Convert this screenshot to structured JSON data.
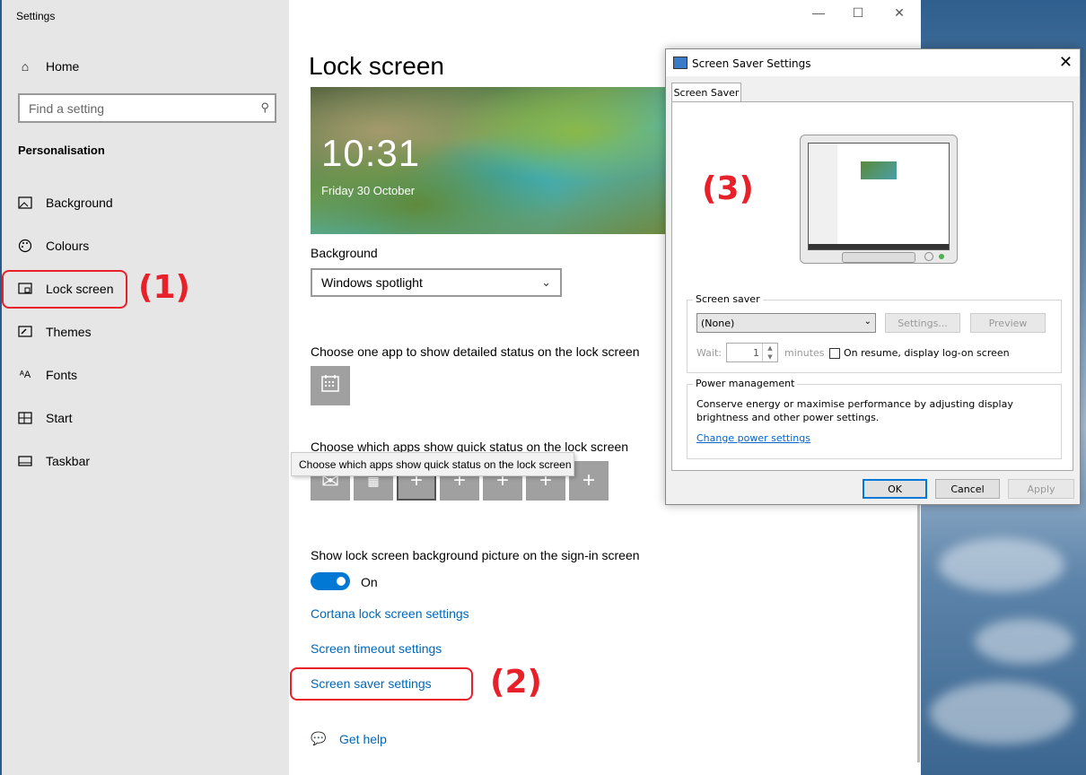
{
  "settings": {
    "window_title": "Settings",
    "home_label": "Home",
    "search_placeholder": "Find a setting",
    "section_title": "Personalisation",
    "nav_items": [
      {
        "label": "Background",
        "icon": "image-icon"
      },
      {
        "label": "Colours",
        "icon": "palette-icon"
      },
      {
        "label": "Lock screen",
        "icon": "lock-screen-icon"
      },
      {
        "label": "Themes",
        "icon": "brush-icon"
      },
      {
        "label": "Fonts",
        "icon": "font-icon"
      },
      {
        "label": "Start",
        "icon": "start-icon"
      },
      {
        "label": "Taskbar",
        "icon": "taskbar-icon"
      }
    ]
  },
  "main": {
    "title": "Lock screen",
    "preview_time": "10:31",
    "preview_date": "Friday 30 October",
    "background_label": "Background",
    "background_value": "Windows spotlight",
    "detailed_status_label": "Choose one app to show detailed status on the lock screen",
    "quick_status_label": "Choose which apps show quick status on the lock screen",
    "tooltip_text": "Choose which apps show quick status on the lock screen",
    "show_bg_label": "Show lock screen background picture on the sign-in screen",
    "toggle_state": "On",
    "link_cortana": "Cortana lock screen settings",
    "link_timeout": "Screen timeout settings",
    "link_screensaver": "Screen saver settings",
    "get_help": "Get help"
  },
  "annotations": {
    "one": "(1)",
    "two": "(2)",
    "three": "(3)",
    "color": "#e8202a"
  },
  "dialog": {
    "title": "Screen Saver Settings",
    "tab": "Screen Saver",
    "screen_saver_group": "Screen saver",
    "screen_saver_value": "(None)",
    "settings_btn": "Settings...",
    "preview_btn": "Preview",
    "wait_label": "Wait:",
    "wait_value": "1",
    "minutes_label": "minutes",
    "resume_label": "On resume, display log-on screen",
    "power_group": "Power management",
    "power_text": "Conserve energy or maximise performance by adjusting display brightness and other power settings.",
    "power_link": "Change power settings",
    "ok": "OK",
    "cancel": "Cancel",
    "apply": "Apply"
  },
  "colors": {
    "accent": "#0078d4",
    "link": "#0067b8"
  }
}
